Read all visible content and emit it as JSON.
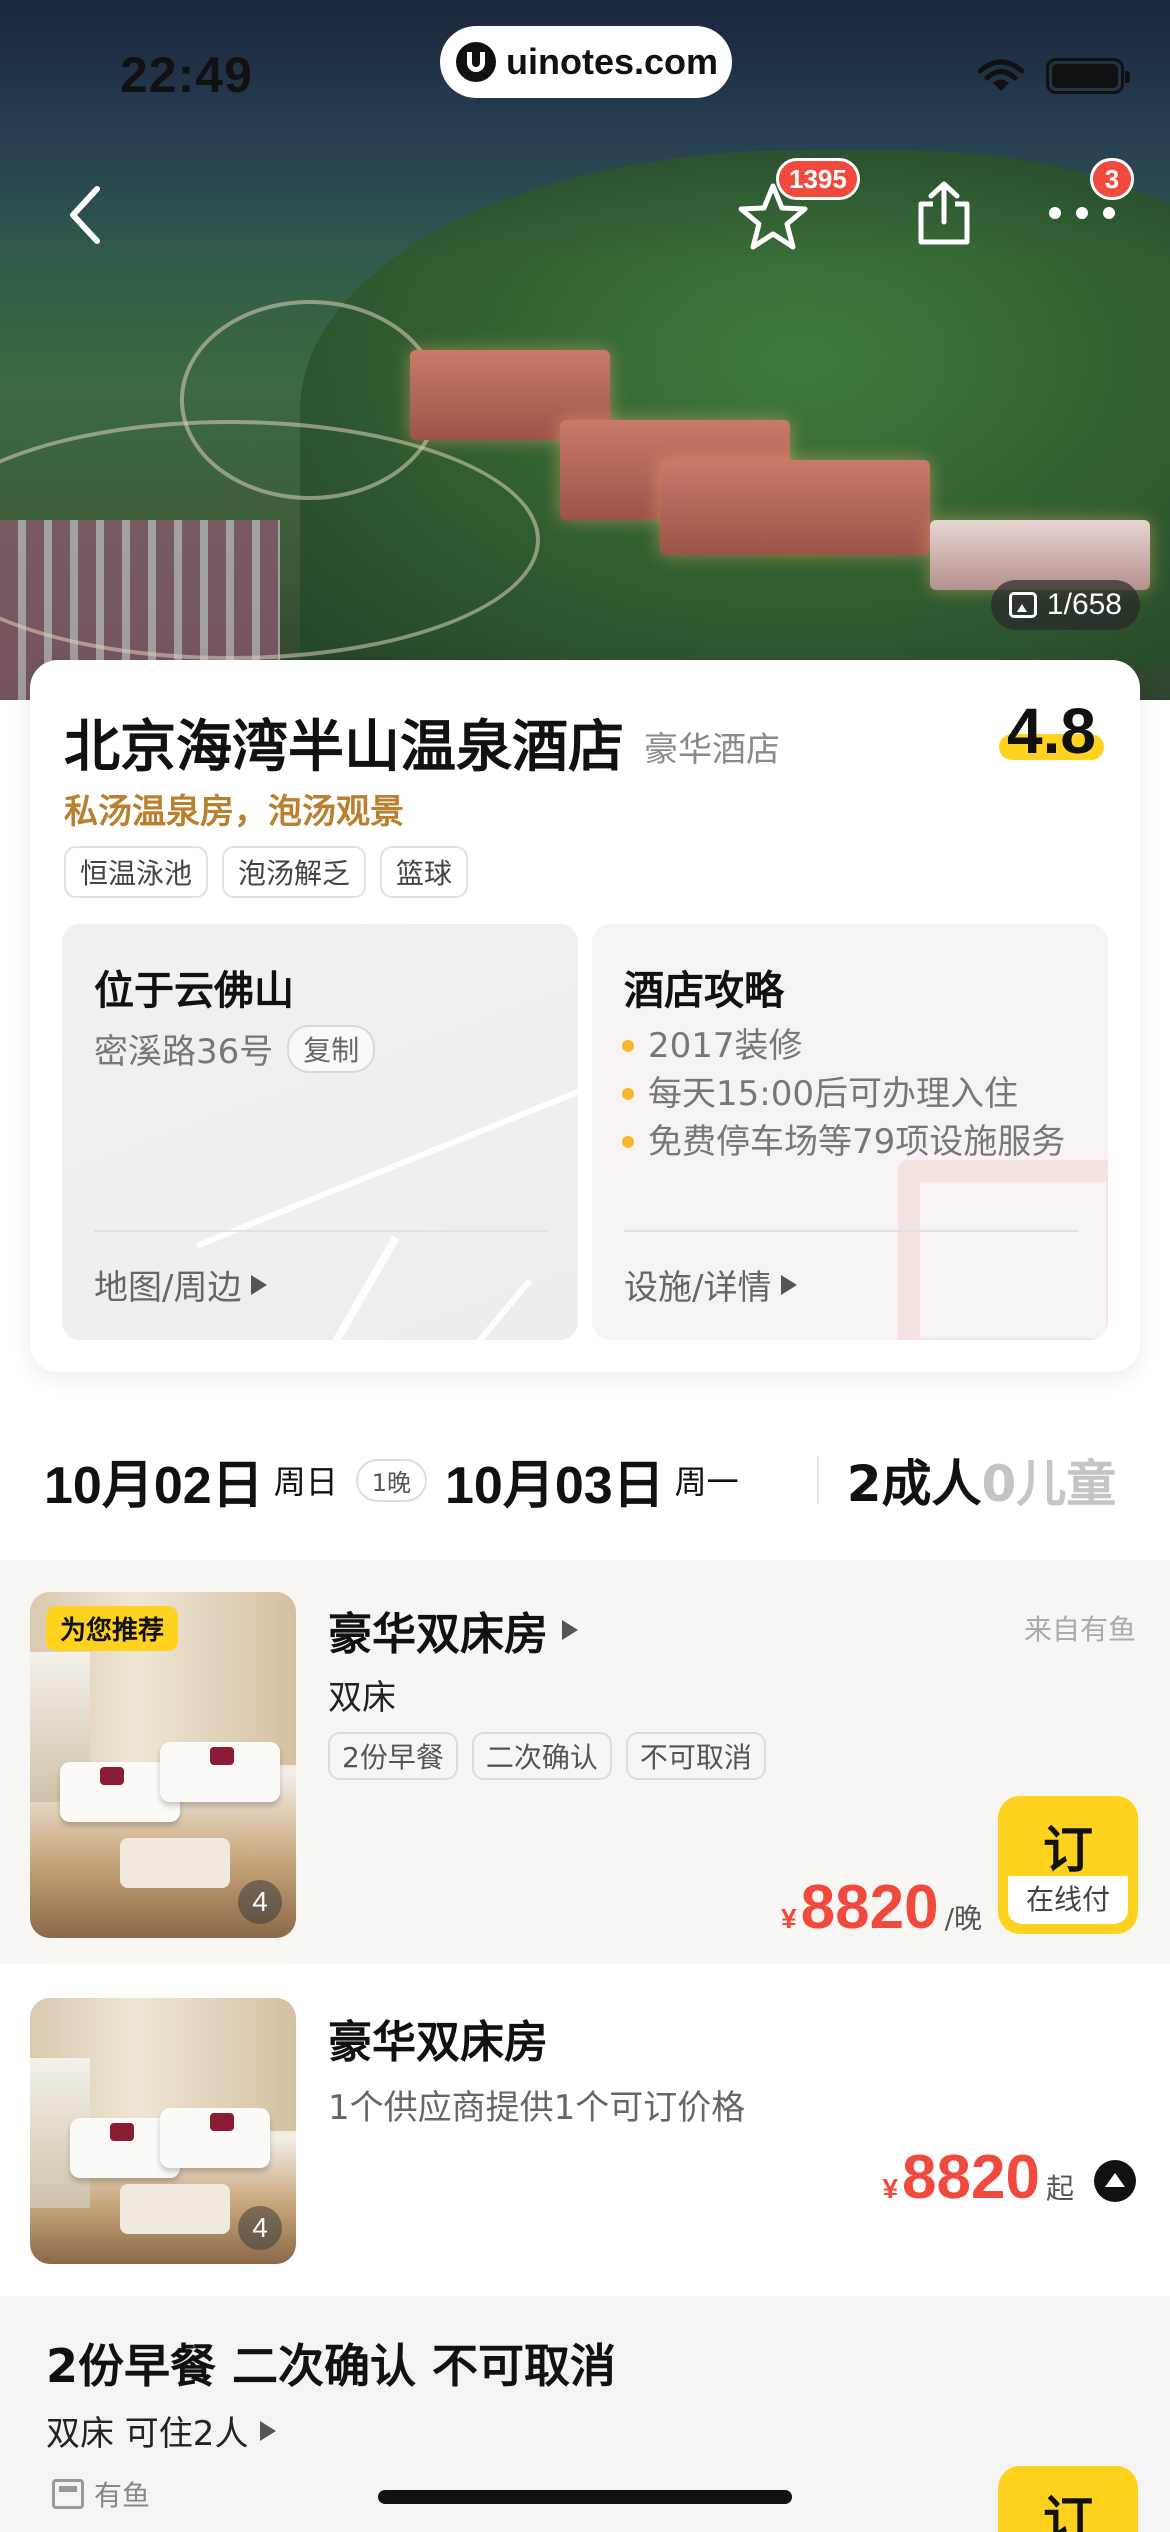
{
  "status_bar": {
    "time": "22:49",
    "url": "uinotes.com"
  },
  "hero": {
    "favorite_count": "1395",
    "more_badge": "3",
    "gallery_count": "1/658"
  },
  "hotel": {
    "name": "北京海湾半山温泉酒店",
    "type": "豪华酒店",
    "rating": "4.8",
    "slogan": "私汤温泉房，泡汤观景",
    "tags": [
      "恒温泳池",
      "泡汤解乏",
      "篮球"
    ]
  },
  "location": {
    "title": "位于云佛山",
    "address": "密溪路36号",
    "copy_label": "复制",
    "link": "地图/周边"
  },
  "guide": {
    "title": "酒店攻略",
    "bullets": [
      "2017装修",
      "每天15:00后可办理入住",
      "免费停车场等79项设施服务"
    ],
    "link": "设施/详情"
  },
  "dates": {
    "checkin": "10月02日",
    "checkin_weekday": "周日",
    "nights": "1晚",
    "checkout": "10月03日",
    "checkout_weekday": "周一",
    "adults": "2成人",
    "children": "0儿童"
  },
  "room1": {
    "badge": "为您推荐",
    "image_count": "4",
    "name": "豪华双床房",
    "source": "来自有鱼",
    "bed": "双床",
    "tags": [
      "2份早餐",
      "二次确认",
      "不可取消"
    ],
    "currency": "¥",
    "price": "8820",
    "unit": "/晚",
    "book_label": "订",
    "book_sub": "在线付"
  },
  "room2": {
    "image_count": "4",
    "name": "豪华双床房",
    "supplier_text": "1个供应商提供1个可订价格",
    "currency": "¥",
    "price": "8820",
    "unit": "起"
  },
  "offer": {
    "title": "2份早餐  二次确认  不可取消",
    "subtitle": "双床  可住2人",
    "source": "有鱼",
    "book_label": "订"
  },
  "colors": {
    "accent": "#ffd21f",
    "price": "#f04a3e",
    "slogan": "#b9812f"
  }
}
